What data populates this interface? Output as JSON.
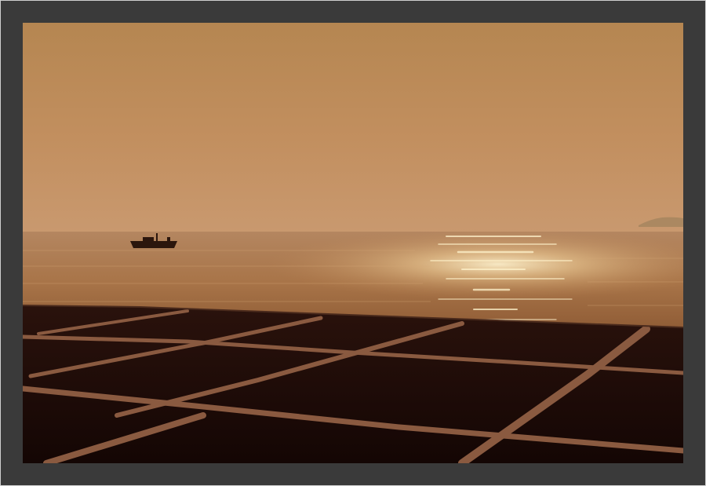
{
  "photo": {
    "subject": "sunset-over-sea",
    "colors": {
      "frame": "#3a3a3a",
      "sky_top": "#b98d5a",
      "sky_horizon": "#c4946a",
      "sea": "#a87448",
      "glare": "#fff2c8",
      "pier_dark": "#1c0b08",
      "pier_lines": "#8a5a40"
    }
  }
}
